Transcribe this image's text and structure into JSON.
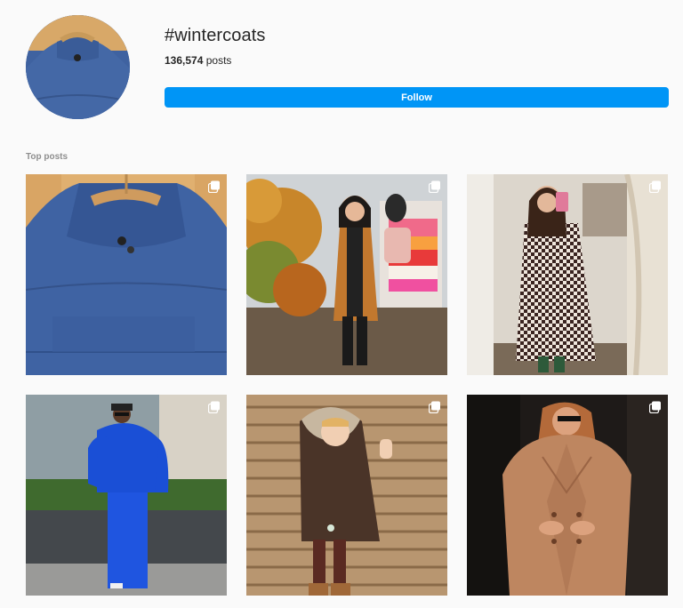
{
  "header": {
    "hashtag": "#wintercoats",
    "post_count": "136,574",
    "post_count_suffix": " posts",
    "follow_label": "Follow"
  },
  "sections": {
    "top_posts_label": "Top posts"
  },
  "colors": {
    "follow_button": "#0095f6",
    "page_background": "#fafafa",
    "section_label": "#8e8e8e"
  },
  "posts": [
    {
      "id": "post-1",
      "icon": "multiple-images-icon"
    },
    {
      "id": "post-2",
      "icon": "multiple-images-icon"
    },
    {
      "id": "post-3",
      "icon": "multiple-images-icon"
    },
    {
      "id": "post-4",
      "icon": "multiple-images-icon"
    },
    {
      "id": "post-5",
      "icon": "multiple-images-icon"
    },
    {
      "id": "post-6",
      "icon": "multiple-images-icon"
    }
  ]
}
